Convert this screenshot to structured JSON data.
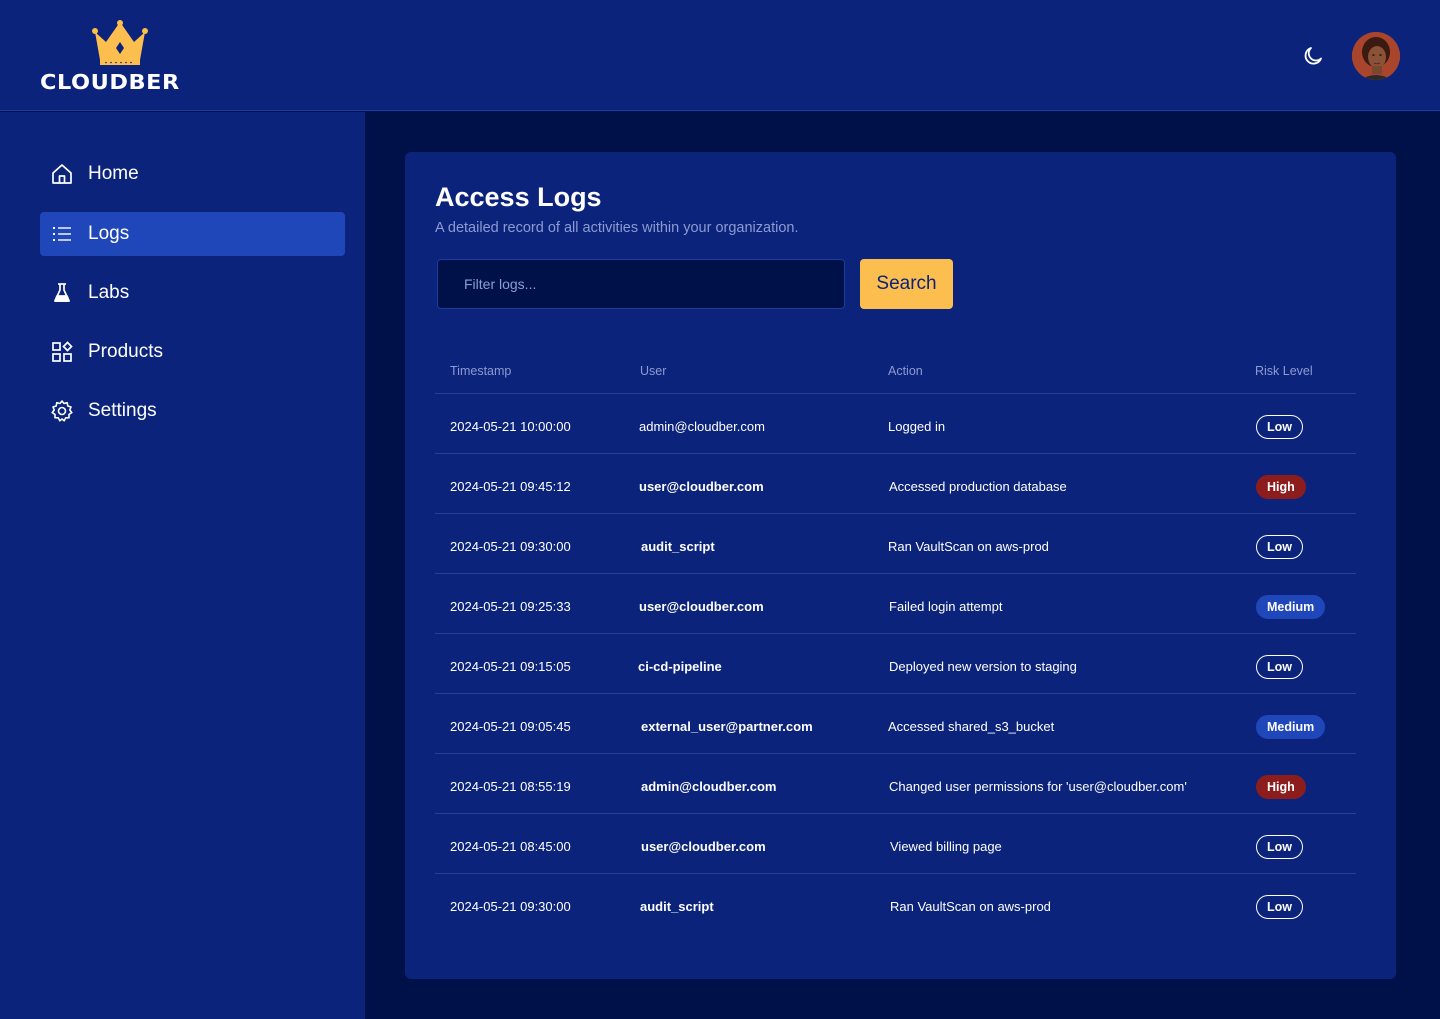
{
  "brand": {
    "name": "CLOUDBER"
  },
  "header": {
    "theme_toggle_icon": "moon-icon",
    "avatar_icon": "user-avatar"
  },
  "sidebar": {
    "items": [
      {
        "label": "Home",
        "icon": "home-icon",
        "active": false
      },
      {
        "label": "Logs",
        "icon": "list-icon",
        "active": true
      },
      {
        "label": "Labs",
        "icon": "flask-icon",
        "active": false
      },
      {
        "label": "Products",
        "icon": "grid-icon",
        "active": false
      },
      {
        "label": "Settings",
        "icon": "gear-icon",
        "active": false
      }
    ]
  },
  "main": {
    "title": "Access Logs",
    "subtitle": "A detailed record of all activities within your organization.",
    "filter": {
      "placeholder": "Filter logs...",
      "value": ""
    },
    "search_label": "Search",
    "columns": [
      "Timestamp",
      "User",
      "Action",
      "Risk Level"
    ],
    "rows": [
      {
        "timestamp": "2024-05-21 10:00:00",
        "user": "admin@cloudber.com",
        "action": "Logged in",
        "risk": "Low"
      },
      {
        "timestamp": "2024-05-21 09:45:12",
        "user": "user@cloudber.com",
        "action": "Accessed production database",
        "risk": "High"
      },
      {
        "timestamp": "2024-05-21 09:30:00",
        "user": "audit_script",
        "action": "Ran VaultScan on aws-prod",
        "risk": "Low"
      },
      {
        "timestamp": "2024-05-21 09:25:33",
        "user": "user@cloudber.com",
        "action": "Failed login attempt",
        "risk": "Medium"
      },
      {
        "timestamp": "2024-05-21 09:15:05",
        "user": "ci-cd-pipeline",
        "action": "Deployed new version to staging",
        "risk": "Low"
      },
      {
        "timestamp": "2024-05-21 09:05:45",
        "user": "external_user@partner.com",
        "action": "Accessed shared_s3_bucket",
        "risk": "Medium"
      },
      {
        "timestamp": "2024-05-21 08:55:19",
        "user": "admin@cloudber.com",
        "action": "Changed user permissions for 'user@cloudber.com'",
        "risk": "High"
      },
      {
        "timestamp": "2024-05-21 08:45:00",
        "user": "user@cloudber.com",
        "action": "Viewed billing page",
        "risk": "Low"
      },
      {
        "timestamp": "2024-05-21 09:30:00",
        "user": "audit_script",
        "action": "Ran VaultScan on aws-prod",
        "risk": "Low"
      }
    ]
  },
  "colors": {
    "background": "#00114a",
    "panel": "#0b237b",
    "accent": "#fcbe4f",
    "active_nav": "#2047b9",
    "risk_low": "#ffffff",
    "risk_medium": "#2047b9",
    "risk_high": "#8d1d1d"
  }
}
